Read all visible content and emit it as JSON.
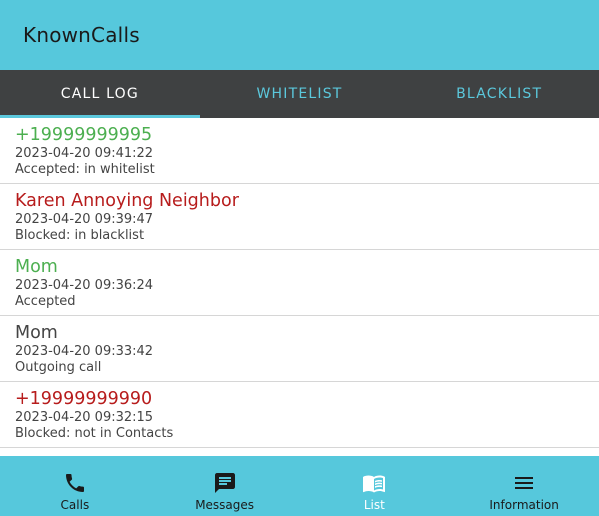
{
  "app": {
    "title": "KnownCalls"
  },
  "colors": {
    "accent": "#56c8dc",
    "tab_bar": "#3f4142",
    "accepted": "#4caf50",
    "blocked": "#b71c1c",
    "neutral": "#444444"
  },
  "tabs": [
    {
      "label": "CALL LOG",
      "active": true
    },
    {
      "label": "WHITELIST",
      "active": false
    },
    {
      "label": "BLACKLIST",
      "active": false
    }
  ],
  "call_log": [
    {
      "name": "+19999999995",
      "time": "2023-04-20 09:41:22",
      "status": "Accepted: in whitelist",
      "kind": "accepted"
    },
    {
      "name": "Karen Annoying Neighbor",
      "time": "2023-04-20 09:39:47",
      "status": "Blocked: in blacklist",
      "kind": "blocked"
    },
    {
      "name": "Mom",
      "time": "2023-04-20 09:36:24",
      "status": "Accepted",
      "kind": "accepted"
    },
    {
      "name": "Mom",
      "time": "2023-04-20 09:33:42",
      "status": "Outgoing call",
      "kind": "neutral"
    },
    {
      "name": "+19999999990",
      "time": "2023-04-20 09:32:15",
      "status": "Blocked: not in Contacts",
      "kind": "blocked"
    }
  ],
  "bottom_nav": [
    {
      "label": "Calls",
      "icon": "phone-icon",
      "active": false
    },
    {
      "label": "Messages",
      "icon": "message-icon",
      "active": false
    },
    {
      "label": "List",
      "icon": "book-icon",
      "active": true
    },
    {
      "label": "Information",
      "icon": "menu-icon",
      "active": false
    }
  ]
}
